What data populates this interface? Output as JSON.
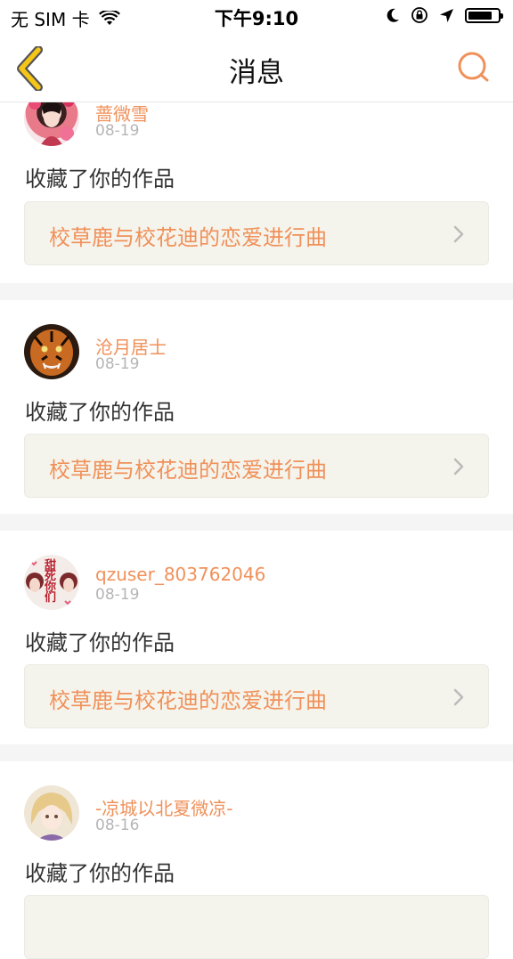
{
  "status_bar": {
    "carrier": "无 SIM 卡",
    "time": "下午9:10"
  },
  "nav": {
    "title": "消息",
    "back_icon": "chevron-left-icon",
    "search_icon": "search-icon"
  },
  "colors": {
    "accent": "#f0915a",
    "back_arrow": "#f5c518",
    "link_bg": "#f5f4ec"
  },
  "messages": [
    {
      "user": "蔷微雪",
      "date": "08-19",
      "action": "收藏了你的作品",
      "work_title": "校草鹿与校花迪的恋爱进行曲"
    },
    {
      "user": "沧月居士",
      "date": "08-19",
      "action": "收藏了你的作品",
      "work_title": "校草鹿与校花迪的恋爱进行曲"
    },
    {
      "user": "qzuser_803762046",
      "date": "08-19",
      "action": "收藏了你的作品",
      "work_title": "校草鹿与校花迪的恋爱进行曲",
      "avatar_text": "甜死你们"
    },
    {
      "user": "-凉城以北夏微凉-",
      "date": "08-16",
      "action": "收藏了你的作品",
      "work_title": ""
    }
  ]
}
